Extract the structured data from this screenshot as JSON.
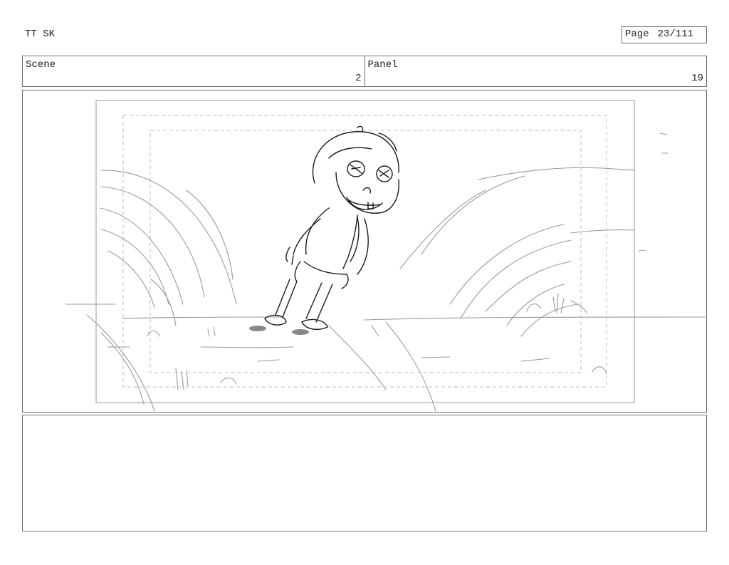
{
  "header": {
    "project_title": "TT SK",
    "page_label": "Page",
    "page_value": "23/111"
  },
  "scene": {
    "label": "Scene",
    "value": "2"
  },
  "panel": {
    "label": "Panel",
    "value": "19"
  },
  "drawing": {
    "subject": "sketch of a smiling child leaning forward in tall grass",
    "line_color": "#1a1a1a",
    "grass_color": "#9a9a9a",
    "guide_color": "#bdbdbd"
  },
  "notes": {
    "text": ""
  }
}
